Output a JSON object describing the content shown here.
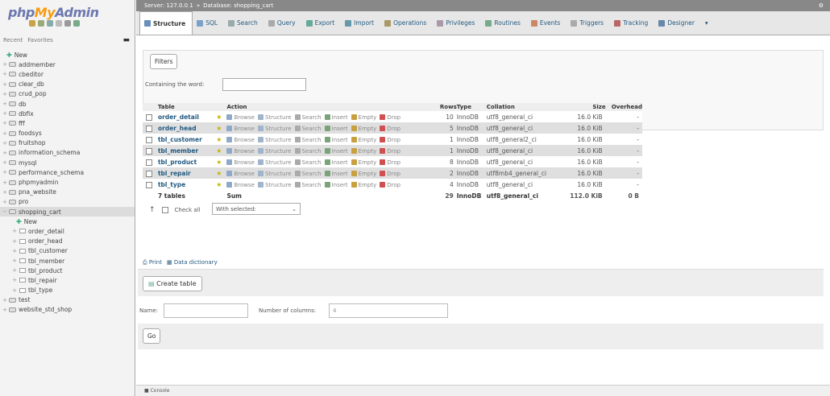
{
  "sidebar": {
    "logo_php": "php",
    "logo_my": "My",
    "logo_admin": "Admin",
    "recent": "Recent",
    "favorites": "Favorites",
    "databases": [
      {
        "label": "New",
        "type": "new"
      },
      {
        "label": "addmember"
      },
      {
        "label": "cbeditor"
      },
      {
        "label": "clear_db"
      },
      {
        "label": "crud_pop"
      },
      {
        "label": "db"
      },
      {
        "label": "dbfix"
      },
      {
        "label": "fff"
      },
      {
        "label": "foodsys"
      },
      {
        "label": "fruitshop"
      },
      {
        "label": "information_schema"
      },
      {
        "label": "mysql"
      },
      {
        "label": "performance_schema"
      },
      {
        "label": "phpmyadmin"
      },
      {
        "label": "pna_website"
      },
      {
        "label": "pro"
      },
      {
        "label": "shopping_cart",
        "active": true
      },
      {
        "label": "New",
        "type": "child-new"
      },
      {
        "label": "order_detail",
        "type": "child"
      },
      {
        "label": "order_head",
        "type": "child"
      },
      {
        "label": "tbl_customer",
        "type": "child"
      },
      {
        "label": "tbl_member",
        "type": "child"
      },
      {
        "label": "tbl_product",
        "type": "child"
      },
      {
        "label": "tbl_repair",
        "type": "child"
      },
      {
        "label": "tbl_type",
        "type": "child"
      },
      {
        "label": "test"
      },
      {
        "label": "website_std_shop"
      }
    ]
  },
  "topbar": {
    "server": "Server: 127.0.0.1",
    "sep": "»",
    "database": "Database: shopping_cart"
  },
  "tabs": [
    {
      "label": "Structure",
      "active": true,
      "color": "#6b8fb6"
    },
    {
      "label": "SQL",
      "color": "#7aa2c8"
    },
    {
      "label": "Search",
      "color": "#9aa"
    },
    {
      "label": "Query",
      "color": "#aaa"
    },
    {
      "label": "Export",
      "color": "#6a9"
    },
    {
      "label": "Import",
      "color": "#69a"
    },
    {
      "label": "Operations",
      "color": "#a96"
    },
    {
      "label": "Privileges",
      "color": "#a9a"
    },
    {
      "label": "Routines",
      "color": "#7a8"
    },
    {
      "label": "Events",
      "color": "#c86"
    },
    {
      "label": "Triggers",
      "color": "#aaa"
    },
    {
      "label": "Tracking",
      "color": "#b66"
    },
    {
      "label": "Designer",
      "color": "#68a"
    }
  ],
  "filters": {
    "button": "Filters",
    "containing_label": "Containing the word:"
  },
  "table": {
    "headers": [
      "Table",
      "Action",
      "Rows",
      "Type",
      "Collation",
      "Size",
      "Overhead"
    ],
    "actions": [
      {
        "label": "Browse",
        "color": "#8fa9c8"
      },
      {
        "label": "Structure",
        "color": "#a0b4cc"
      },
      {
        "label": "Search",
        "color": "#aaa"
      },
      {
        "label": "Insert",
        "color": "#7aa37a"
      },
      {
        "label": "Empty",
        "color": "#c8a040"
      },
      {
        "label": "Drop",
        "color": "#d05050"
      }
    ],
    "rows": [
      {
        "name": "order_detail",
        "rows": "10",
        "type": "InnoDB",
        "collation": "utf8_general_ci",
        "size": "16.0 KiB",
        "overhead": "-"
      },
      {
        "name": "order_head",
        "rows": "5",
        "type": "InnoDB",
        "collation": "utf8_general_ci",
        "size": "16.0 KiB",
        "overhead": "-"
      },
      {
        "name": "tbl_customer",
        "rows": "1",
        "type": "InnoDB",
        "collation": "utf8_general2_ci",
        "size": "16.0 KiB",
        "overhead": "-"
      },
      {
        "name": "tbl_member",
        "rows": "1",
        "type": "InnoDB",
        "collation": "utf8_general_ci",
        "size": "16.0 KiB",
        "overhead": "-"
      },
      {
        "name": "tbl_product",
        "rows": "8",
        "type": "InnoDB",
        "collation": "utf8_general_ci",
        "size": "16.0 KiB",
        "overhead": "-"
      },
      {
        "name": "tbl_repair",
        "rows": "2",
        "type": "InnoDB",
        "collation": "utf8mb4_general_ci",
        "size": "16.0 KiB",
        "overhead": "-"
      },
      {
        "name": "tbl_type",
        "rows": "4",
        "type": "InnoDB",
        "collation": "utf8_general_ci",
        "size": "16.0 KiB",
        "overhead": "-"
      }
    ],
    "sum": {
      "tables": "7 tables",
      "label": "Sum",
      "rows": "29",
      "type": "InnoDB",
      "collation": "utf8_general_ci",
      "size": "112.0 KiB",
      "overhead": "0 B"
    }
  },
  "check_all": "Check all",
  "with_selected": "With selected:",
  "print_label": "Print",
  "data_dictionary": "Data dictionary",
  "create_table": "Create table",
  "name_label": "Name:",
  "columns_label": "Number of columns:",
  "columns_value": "4",
  "go": "Go",
  "console": "Console"
}
